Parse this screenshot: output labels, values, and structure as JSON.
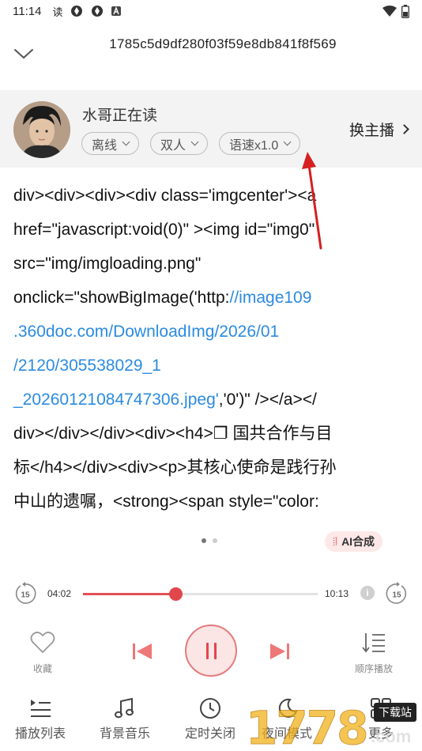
{
  "status_bar": {
    "time": "11:14",
    "read_badge": "读"
  },
  "header": {
    "title": "1785c5d9df280f03f59e8db841f8f569"
  },
  "reader": {
    "name": "水哥正在读",
    "chips": {
      "offline": "离线",
      "dual": "双人",
      "speed": "语速x1.0"
    },
    "switch_anchor": "换主播"
  },
  "content": {
    "line1": "div><div><div><div class='imgcenter'><a",
    "line2": "href=\"javascript:void(0)\"  ><img id=\"img0\"",
    "line3": "src=\"img/imgloading.png\"",
    "line4_prefix": "onclick=\"showBigImage('http:",
    "line4_link": "//image109",
    "line5_link": ".360doc.com/DownloadImg/2026/01",
    "line6_link": "/2120/305538029_1",
    "line7_link": "_20260121084747306.jpeg'",
    "line7_suffix": ",'0')\" /></a></",
    "line8": "div></div></div><div><h4>❐ 国共合作与目",
    "line9": "标</h4></div><div><p>其核心使命是践行孙",
    "line10": "中山的遗嘱，<strong><span style=\"color:"
  },
  "ai_badge": "AI合成",
  "player": {
    "current_time": "04:02",
    "total_time": "10:13",
    "progress_fraction": 0.395,
    "skip_back_seconds": "15",
    "skip_forward_seconds": "15",
    "favorite_label": "收藏",
    "order_label": "顺序播放"
  },
  "bottom_tabs": {
    "playlist": "播放列表",
    "bg_music": "背景音乐",
    "timer": "定时关闭",
    "night": "夜间模式",
    "more": "更多"
  },
  "watermark": {
    "digits": "1778",
    "com": ".com",
    "site": "下载站"
  },
  "colors": {
    "accent": "#e0474c",
    "link": "#2b8be0",
    "card_bg": "#f3f3f3"
  }
}
